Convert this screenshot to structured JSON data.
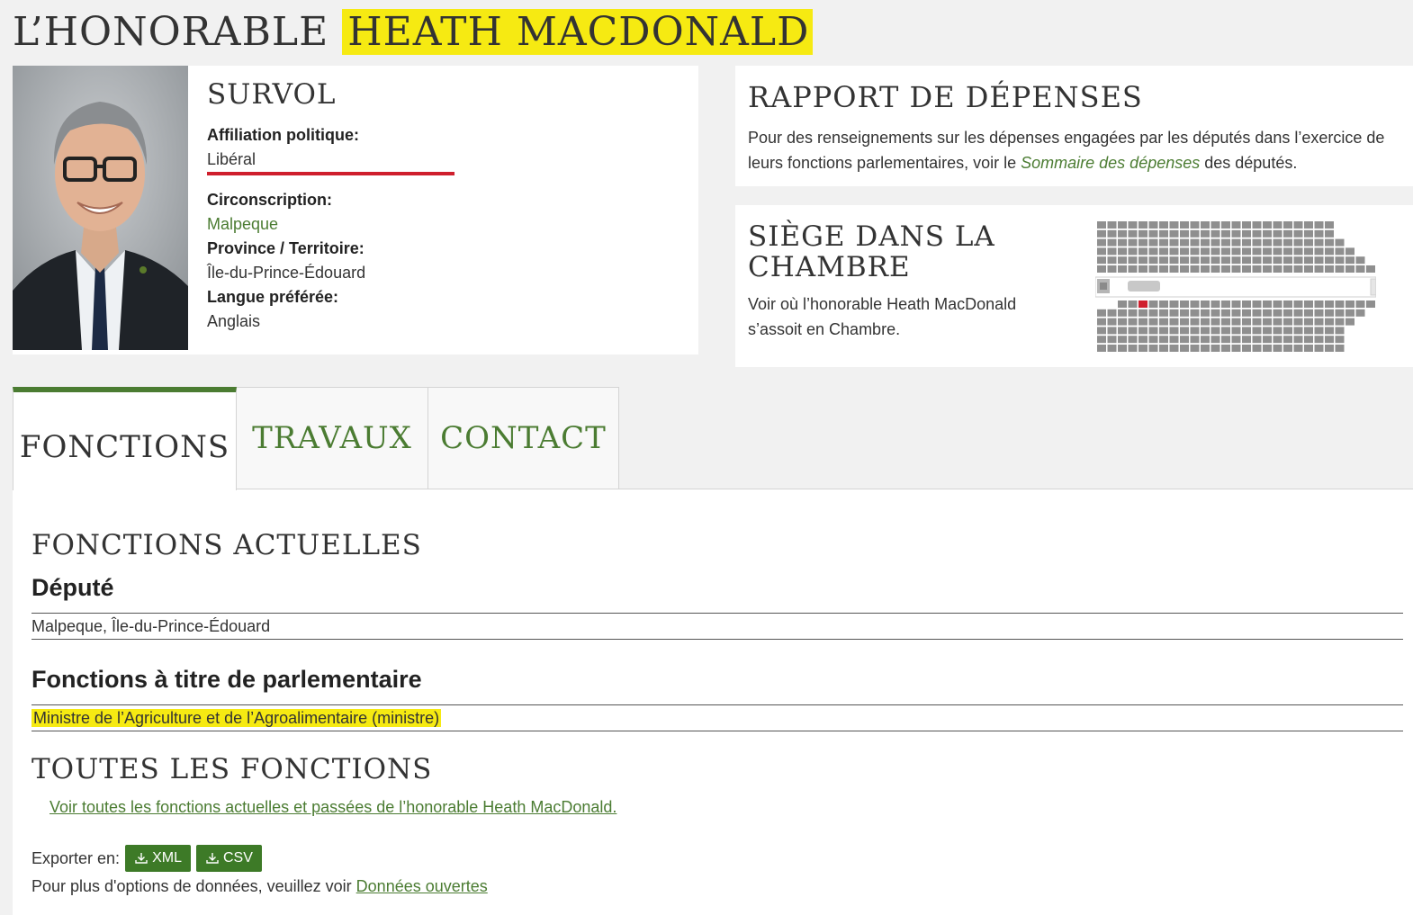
{
  "page": {
    "title_prefix": "L’HONORABLE",
    "title_name": "HEATH MACDONALD"
  },
  "overview": {
    "title": "SURVOL",
    "party_label": "Affiliation politique:",
    "party_value": "Libéral",
    "riding_label": "Circonscription:",
    "riding_value": "Malpeque",
    "province_label": "Province / Territoire:",
    "province_value": "Île-du-Prince-Édouard",
    "language_label": "Langue préférée:",
    "language_value": "Anglais",
    "party_color": "#cf1f2d"
  },
  "expenses": {
    "title": "RAPPORT DE DÉPENSES",
    "text_before": "Pour des renseignements sur les dépenses engagées par les députés dans l’exercice de leurs fonctions parlementaires, voir le ",
    "link": "Sommaire des dépenses",
    "text_after": " des députés."
  },
  "seat": {
    "title": "SIÈGE DANS LA CHAMBRE",
    "text": "Voir où l’honorable Heath MacDonald s’assoit en Chambre."
  },
  "tabs": [
    {
      "label": "FONCTIONS",
      "active": true
    },
    {
      "label": "TRAVAUX",
      "active": false
    },
    {
      "label": "CONTACT",
      "active": false
    }
  ],
  "content": {
    "current_heading": "FONCTIONS ACTUELLES",
    "mp_heading": "Député",
    "mp_value": "Malpeque, Île-du-Prince-Édouard",
    "parl_heading": "Fonctions à titre de parlementaire",
    "parl_value": "Ministre de l’Agriculture et de l’Agroalimentaire (ministre)",
    "all_heading": "TOUTES LES FONCTIONS",
    "all_link": "Voir toutes les fonctions actuelles et passées de l’honorable Heath MacDonald.",
    "export_label": "Exporter en:",
    "xml_label": "XML",
    "csv_label": "CSV",
    "open_data_text": "Pour plus d'options de données, veuillez voir ",
    "open_data_link": "Données ouvertes"
  },
  "colors": {
    "accent": "#4b7c32",
    "button": "#3d7a27",
    "highlight": "#f6ea12"
  }
}
